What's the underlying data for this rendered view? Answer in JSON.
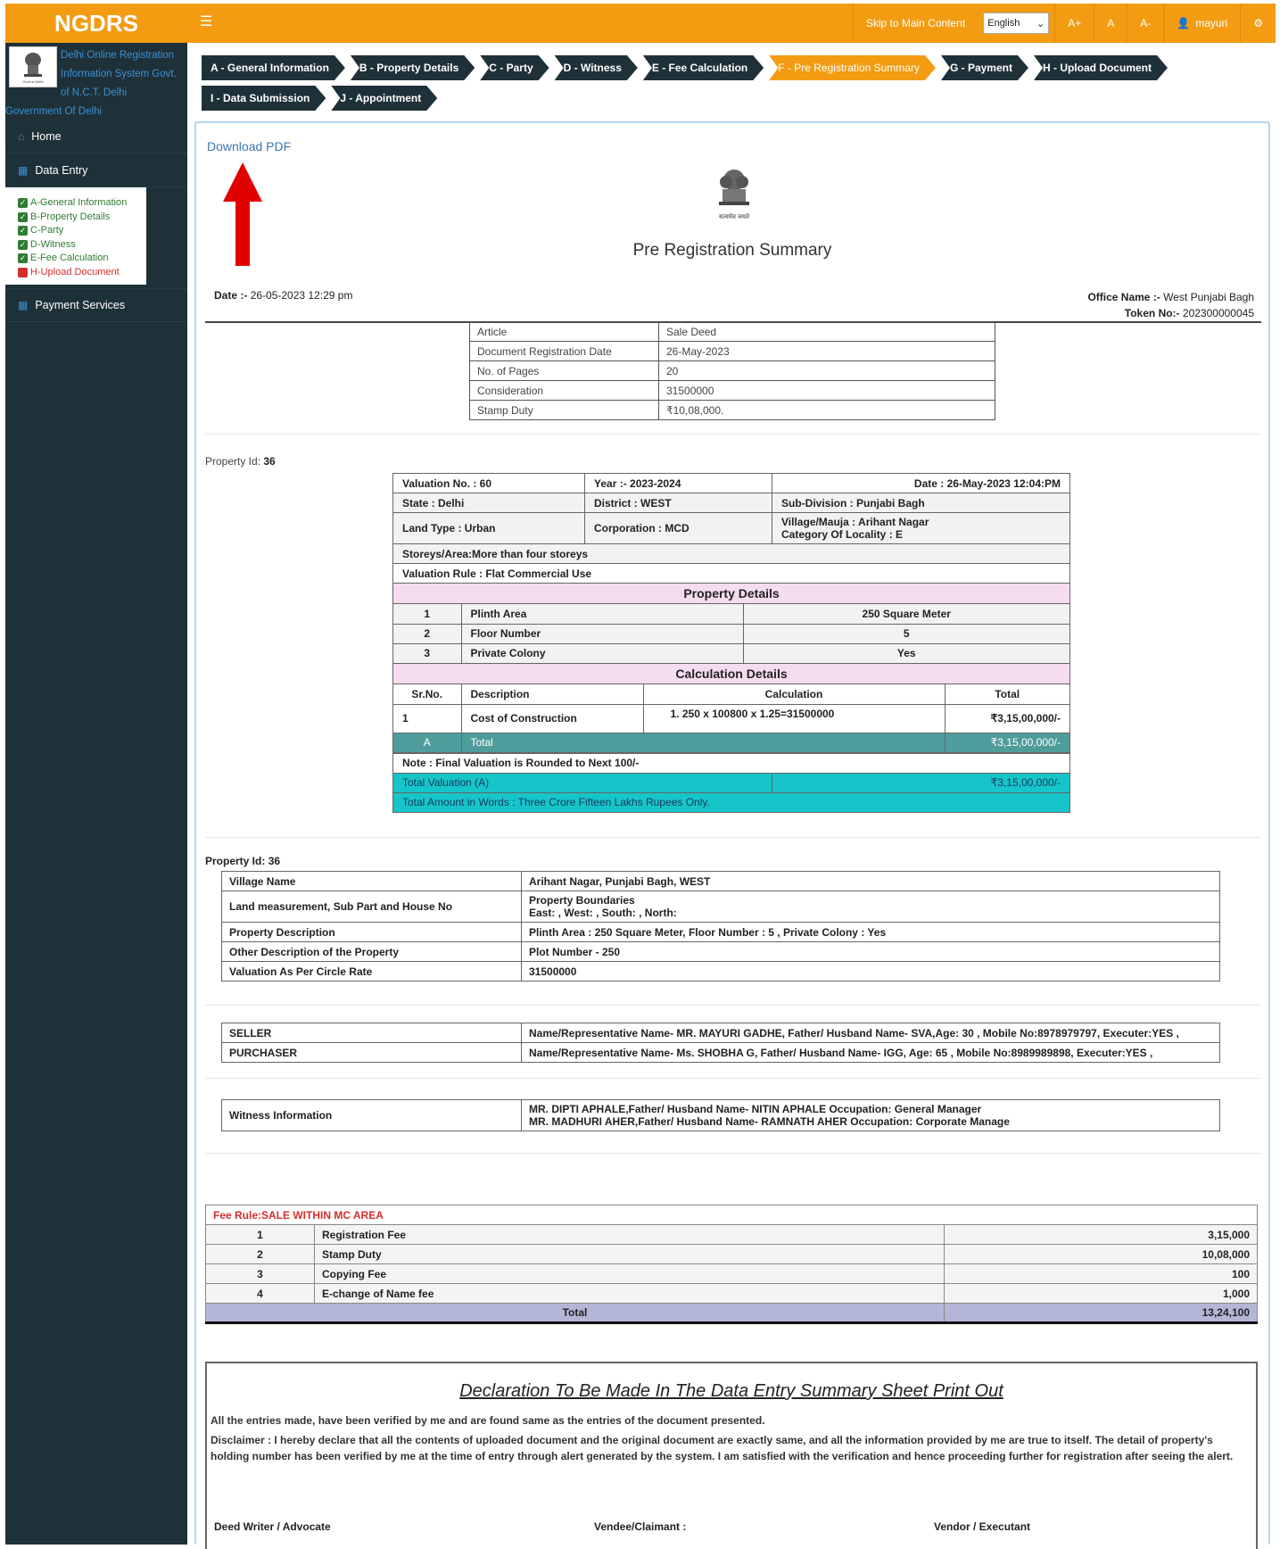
{
  "brand": {
    "name": "NGDRS",
    "subtitle": "Delhi Online Registration Information System Govt. of N.C.T. Delhi",
    "subtitle2": "Government Of Delhi"
  },
  "sidebar": {
    "home": "Home",
    "data_entry": "Data Entry",
    "sub_items": [
      {
        "label": "A-General Information",
        "status": "done"
      },
      {
        "label": "B-Property Details",
        "status": "done"
      },
      {
        "label": "C-Party",
        "status": "done"
      },
      {
        "label": "D-Witness",
        "status": "done"
      },
      {
        "label": "E-Fee Calculation",
        "status": "done"
      },
      {
        "label": "H-Upload Document",
        "status": "pending"
      }
    ],
    "payment": "Payment Services"
  },
  "topbar": {
    "skip": "Skip to Main Content",
    "language": "English",
    "font_up": "A+",
    "font_normal": "A",
    "font_down": "A-",
    "user": "mayuri"
  },
  "tabs": [
    {
      "label": "A - General Information"
    },
    {
      "label": "B - Property Details"
    },
    {
      "label": "C - Party"
    },
    {
      "label": "D - Witness"
    },
    {
      "label": "E - Fee Calculation"
    },
    {
      "label": "F - Pre Registration Summary",
      "active": true
    },
    {
      "label": "G - Payment"
    },
    {
      "label": "H - Upload Document"
    },
    {
      "label": "I - Data Submission"
    },
    {
      "label": "J - Appointment"
    }
  ],
  "summary": {
    "download": "Download PDF",
    "emblem_caption": "सत्यमेव जयते",
    "title": "Pre Registration Summary",
    "date_label": "Date :-",
    "date_value": "26-05-2023 12:29 pm",
    "office_label": "Office Name :-",
    "office_value": "West Punjabi Bagh",
    "token_label": "Token No:-",
    "token_value": "202300000045"
  },
  "doc_table": [
    [
      "Article",
      "Sale Deed"
    ],
    [
      "Document Registration Date",
      "26-May-2023"
    ],
    [
      "No. of Pages",
      "20"
    ],
    [
      "Consideration",
      "31500000"
    ],
    [
      "Stamp Duty",
      "₹10,08,000."
    ]
  ],
  "property_id_label": "Property Id:",
  "property_id": "36",
  "valuation": {
    "valuation_no": "Valuation No. : 60",
    "year": "Year :- 2023-2024",
    "date": "Date : 26-May-2023 12:04:PM",
    "state": "State : Delhi",
    "district": "District : WEST",
    "subdivision": "Sub-Division : Punjabi Bagh",
    "land_type": "Land Type : Urban",
    "corporation": "Corporation : MCD",
    "village": "Village/Mauja : Arihant Nagar",
    "locality": "Category Of Locality : E",
    "storeys": "Storeys/Area:More than four storeys",
    "rule": "Valuation Rule : Flat Commercial Use",
    "prop_heading": "Property Details",
    "prop_rows": [
      [
        "1",
        "Plinth Area",
        "250 Square Meter"
      ],
      [
        "2",
        "Floor Number",
        "5"
      ],
      [
        "3",
        "Private Colony",
        "Yes"
      ]
    ],
    "calc_heading": "Calculation Details",
    "calc_head": [
      "Sr.No.",
      "Description",
      "Calculation",
      "Total"
    ],
    "calc_row": [
      "1",
      "Cost of Construction",
      "1.   250 x 100800 x 1.25=31500000",
      "₹3,15,00,000/-"
    ],
    "total_row": [
      "A",
      "Total",
      "₹3,15,00,000/-"
    ],
    "note": "Note : Final Valuation is Rounded to Next 100/-",
    "total_val_label": "Total Valuation (A)",
    "total_val": "₹3,15,00,000/-",
    "words": "Total Amount in Words : Three Crore Fifteen Lakhs Rupees Only."
  },
  "details": [
    [
      "Village Name",
      "Arihant Nagar, Punjabi Bagh, WEST"
    ],
    [
      "Land measurement, Sub Part and House No",
      "Property Boundaries",
      "East: , West: , South: , North:"
    ],
    [
      "Property Description",
      "Plinth Area : 250 Square Meter, Floor Number : 5 , Private Colony : Yes"
    ],
    [
      "Other Description of the Property",
      "Plot Number - 250"
    ],
    [
      "Valuation As Per Circle Rate",
      "31500000"
    ]
  ],
  "parties": [
    [
      "SELLER",
      "Name/Representative Name- MR. MAYURI GADHE, Father/ Husband Name- SVA,Age: 30 , Mobile No:8978979797, Executer:YES ,"
    ],
    [
      "PURCHASER",
      "Name/Representative Name- Ms. SHOBHA G, Father/ Husband Name- IGG, Age: 65 , Mobile No:8989989898, Executer:YES ,"
    ]
  ],
  "witness": {
    "label": "Witness Information",
    "line1": "MR. DIPTI APHALE,Father/ Husband Name- NITIN APHALE Occupation: General Manager",
    "line2": "MR. MADHURI AHER,Father/ Husband Name- RAMNATH AHER Occupation: Corporate Manage"
  },
  "fees": {
    "rule": "Fee Rule:SALE WITHIN MC AREA",
    "rows": [
      [
        "1",
        "Registration Fee",
        "3,15,000"
      ],
      [
        "2",
        "Stamp Duty",
        "10,08,000"
      ],
      [
        "3",
        "Copying Fee",
        "100"
      ],
      [
        "4",
        "E-change of Name fee",
        "1,000"
      ]
    ],
    "total_label": "Total",
    "total": "13,24,100"
  },
  "declaration": {
    "title": "Declaration To Be Made In The Data Entry Summary Sheet Print Out",
    "line1": "All the entries made, have been verified by me and are found same as the entries of the document presented.",
    "line2": "Disclaimer : I hereby declare that all the contents of uploaded document and the original document are exactly same, and all the information provided by me are true to itself. The detail of property's holding number has been verified by me at the time of entry through alert generated by the system. I am satisfied with the verification and hence proceeding further for registration after seeing the alert.",
    "sig1": "Deed Writer / Advocate",
    "sig2": "Vendee/Claimant :",
    "sig3": "Vendor / Executant"
  }
}
